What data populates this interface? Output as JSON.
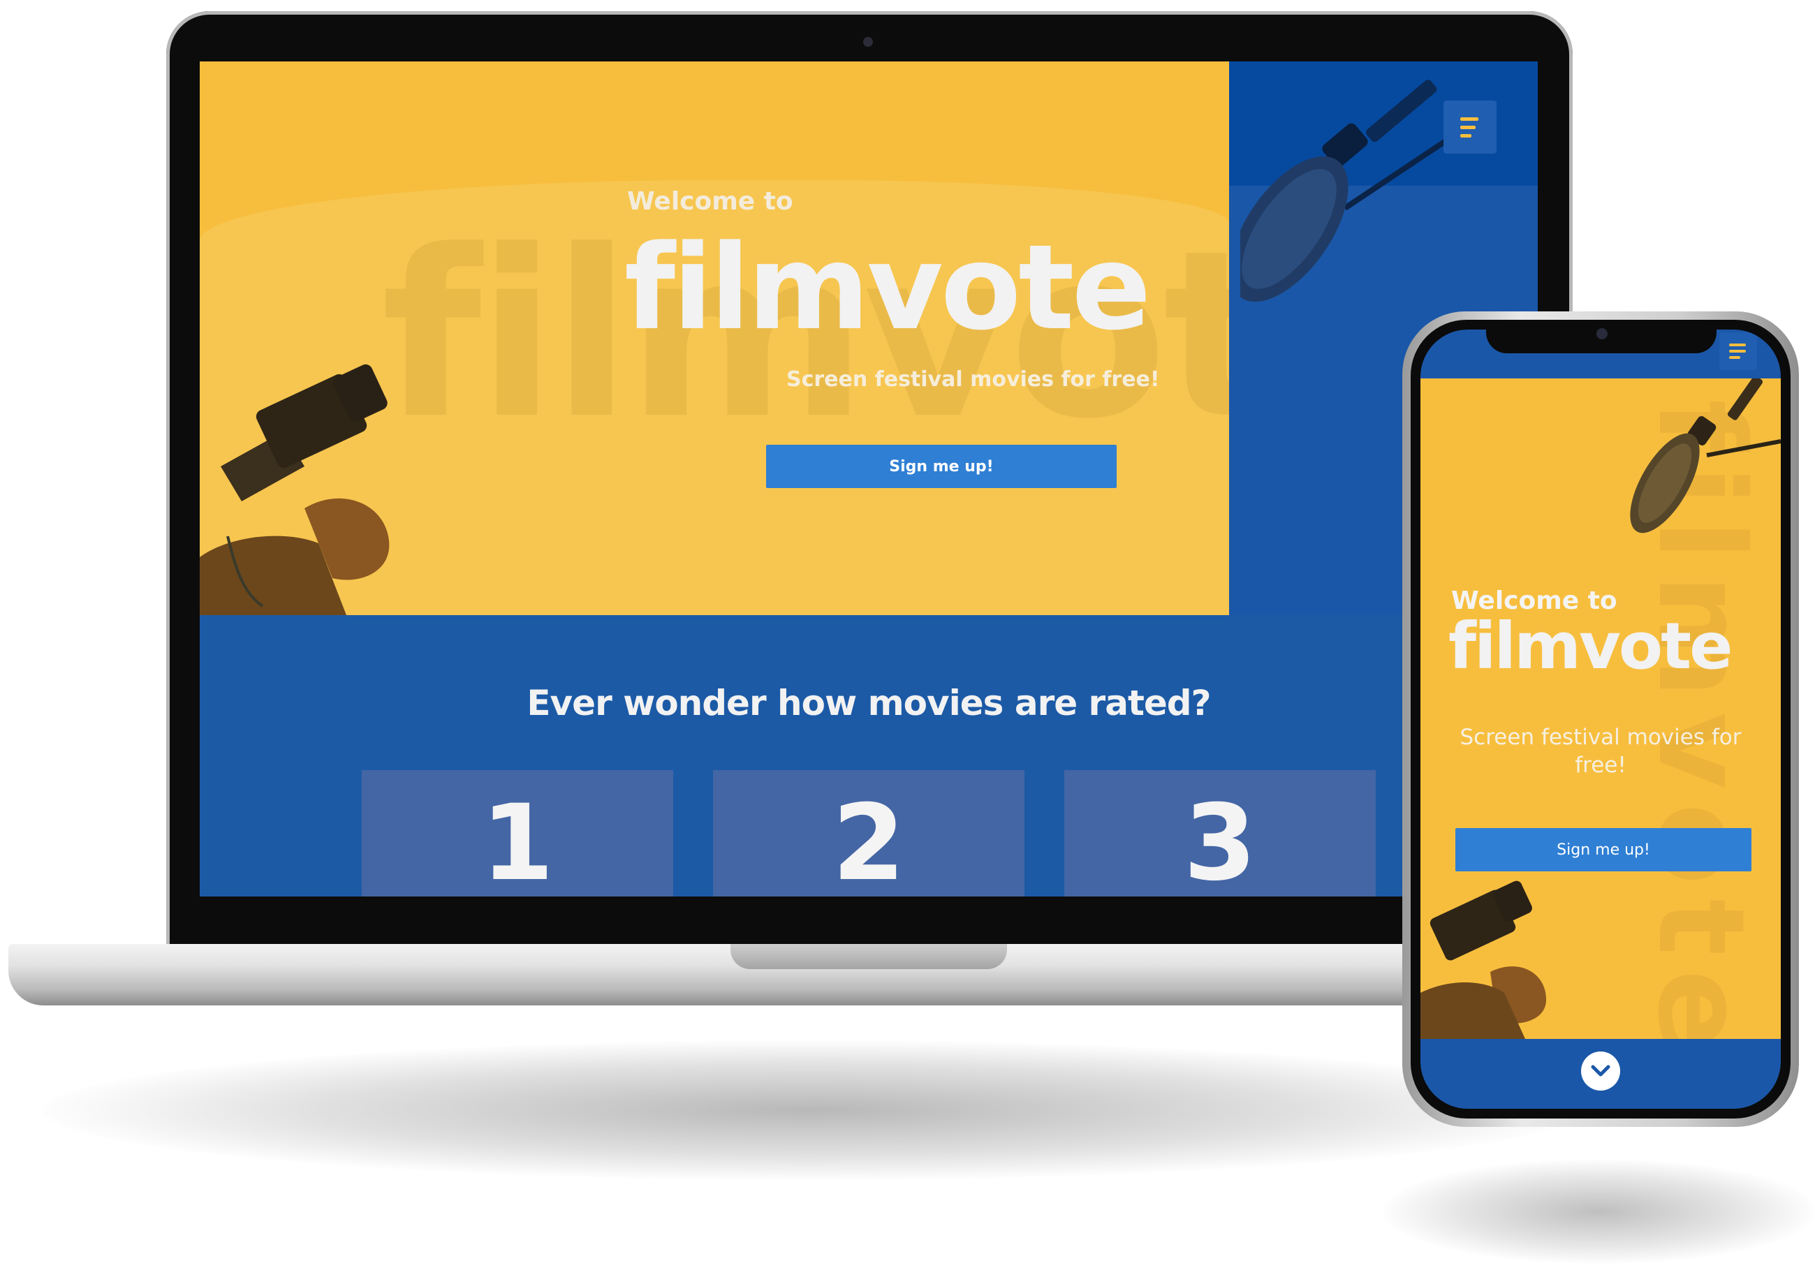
{
  "laptop": {
    "hero": {
      "welcome": "Welcome to",
      "logo": "filmvote",
      "watermark": "filmvote",
      "tagline": "Screen festival movies for free!",
      "signup_label": "Sign me up!"
    },
    "menu_icon": "hamburger-menu-icon",
    "section": {
      "question": "Ever wonder how movies are rated?",
      "steps": [
        "1",
        "2",
        "3"
      ]
    }
  },
  "phone": {
    "hero": {
      "welcome": "Welcome to",
      "logo": "filmvote",
      "watermark": "filmvote",
      "tagline": "Screen festival movies for free!",
      "signup_label": "Sign me up!"
    },
    "menu_icon": "hamburger-menu-icon",
    "scroll_icon": "chevron-down-icon"
  },
  "colors": {
    "yellow": "#f7be3e",
    "blue": "#1c5aa6",
    "button_blue": "#2f7fd4",
    "step_tile": "#4466a5"
  }
}
